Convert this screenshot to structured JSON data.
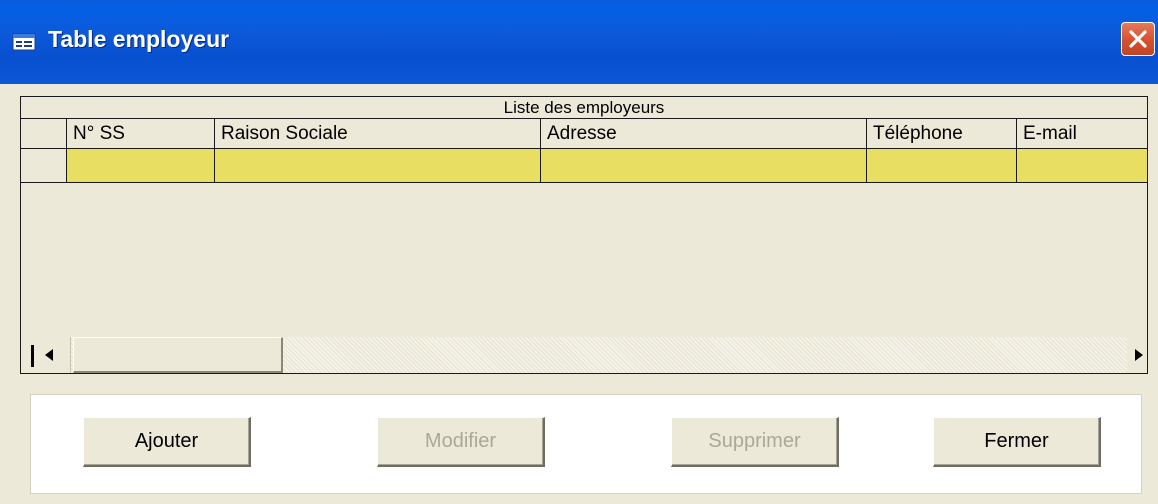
{
  "window": {
    "title": "Table employeur",
    "title_icon": "form-window-icon",
    "close_icon": "close-icon"
  },
  "grid": {
    "caption": "Liste des employeurs",
    "columns": [
      "N° SS",
      "Raison Sociale",
      "Adresse",
      "Téléphone",
      "E-mail"
    ],
    "rows": [
      [
        "",
        "",
        "",
        "",
        ""
      ]
    ],
    "selected_row_color": "#e8de62"
  },
  "scrollbar": {
    "left_icon": "arrow-left-icon",
    "right_icon": "arrow-right-icon"
  },
  "buttons": {
    "add": "Ajouter",
    "edit": "Modifier",
    "delete": "Supprimer",
    "close": "Fermer"
  },
  "colors": {
    "title_bar": "#0c59d9",
    "close_button": "#d4512f",
    "window_bg": "#ece9d8",
    "disabled_text": "#aca899"
  }
}
